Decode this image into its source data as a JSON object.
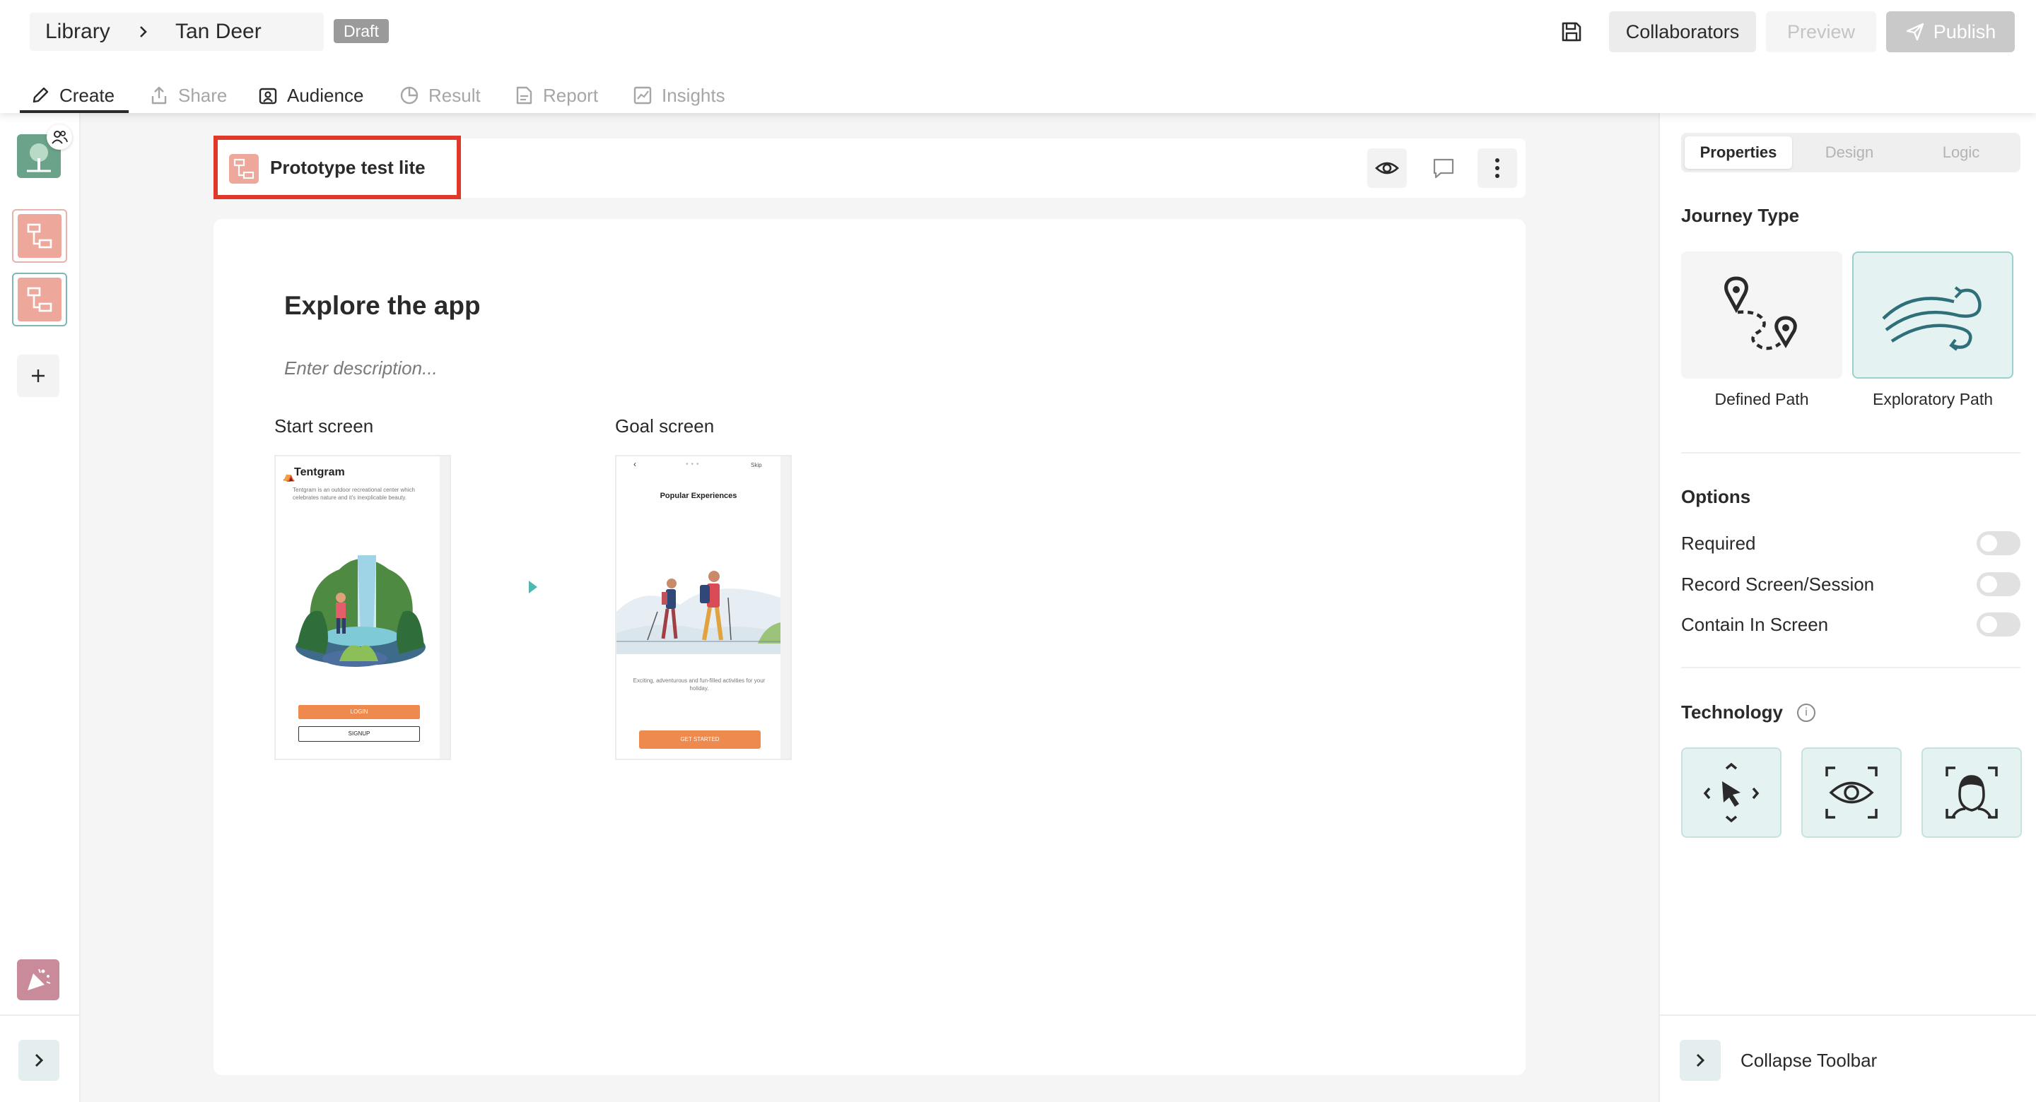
{
  "header": {
    "breadcrumb_root": "Library",
    "project_name": "Tan Deer",
    "status_badge": "Draft",
    "collaborators_label": "Collaborators",
    "preview_label": "Preview",
    "publish_label": "Publish",
    "tabs": [
      {
        "label": "Create",
        "icon": "pencil-icon",
        "active": true
      },
      {
        "label": "Share",
        "icon": "share-icon",
        "active": false
      },
      {
        "label": "Audience",
        "icon": "audience-icon",
        "active": false
      },
      {
        "label": "Result",
        "icon": "pie-chart-icon",
        "active": false
      },
      {
        "label": "Report",
        "icon": "report-icon",
        "active": false
      },
      {
        "label": "Insights",
        "icon": "line-chart-icon",
        "active": false
      }
    ]
  },
  "block": {
    "title": "Prototype test lite",
    "question_title": "Explore the app",
    "description_placeholder": "Enter description...",
    "start_screen_label": "Start screen",
    "goal_screen_label": "Goal screen",
    "start_screen_mock": {
      "brand": "Tentgram",
      "blurb": "Tentgram is an outdoor recreational center which celebrates nature and it's inexplicable beauty.",
      "login_label": "LOGIN",
      "signup_label": "SIGNUP"
    },
    "goal_screen_mock": {
      "skip_label": "Skip",
      "title": "Popular Experiences",
      "blurb": "Exciting, adventurous and fun-filled activities for your holiday.",
      "cta_label": "GET STARTED"
    }
  },
  "panel": {
    "tabs": [
      "Properties",
      "Design",
      "Logic"
    ],
    "journey_type_heading": "Journey Type",
    "journey_options": [
      {
        "label": "Defined Path",
        "selected": false
      },
      {
        "label": "Exploratory Path",
        "selected": true
      }
    ],
    "options_heading": "Options",
    "options": [
      {
        "label": "Required",
        "on": false
      },
      {
        "label": "Record Screen/Session",
        "on": false
      },
      {
        "label": "Contain In Screen",
        "on": false
      }
    ],
    "technology_heading": "Technology",
    "technology_icons": [
      "cursor-navigation-icon",
      "eye-tracking-icon",
      "face-tracking-icon"
    ],
    "collapse_label": "Collapse Toolbar"
  },
  "colors": {
    "accent_teal": "#2d8f8a",
    "selected_bg": "#e4f2f1",
    "highlight_red": "#e0392b",
    "thumb_salmon": "#eea79b",
    "cta_orange": "#ee8a4d"
  }
}
